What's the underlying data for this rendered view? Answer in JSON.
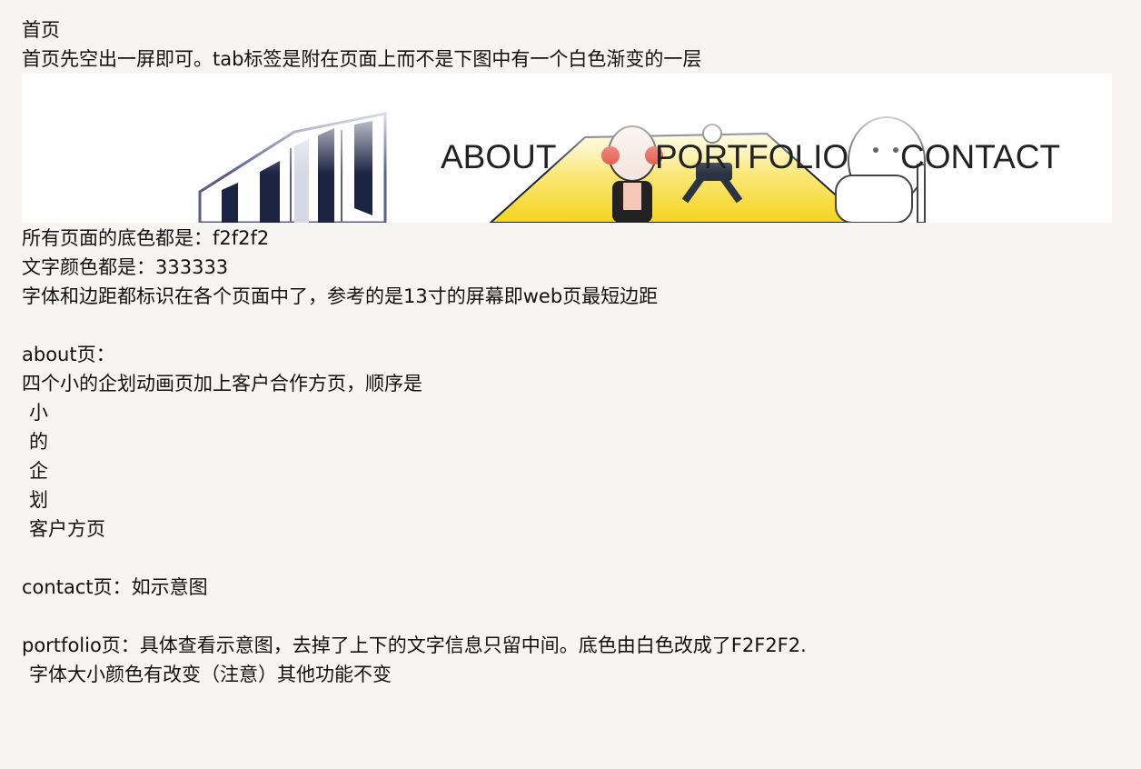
{
  "doc": {
    "heading": "首页",
    "intro": "首页先空出一屏即可。tab标签是附在页面上而不是下图中有一个白色渐变的一层",
    "banner": {
      "tabs": [
        "ABOUT",
        "PORTFOLIO",
        "CONTACT"
      ]
    },
    "lines_after_banner": [
      "所有页面的底色都是：f2f2f2",
      "文字颜色都是：333333",
      "字体和边距都标识在各个页面中了，参考的是13寸的屏幕即web页最短边距"
    ],
    "about": {
      "title": "about页：",
      "desc": "四个小的企划动画页加上客户合作方页，顺序是",
      "items": [
        "小",
        "的",
        "企",
        "划",
        "客户方页"
      ]
    },
    "contact": "contact页：如示意图",
    "portfolio": {
      "line1": "portfolio页：具体查看示意图，去掉了上下的文字信息只留中间。底色由白色改成了F2F2F2.",
      "line2": "字体大小颜色有改变（注意）其他功能不变"
    }
  },
  "colors": {
    "page_background": "#f6f5f1",
    "text": "#111111",
    "banner_background": "#ffffff",
    "banner_yellow": "#f5d41e",
    "banner_navy": "#1c2444"
  }
}
